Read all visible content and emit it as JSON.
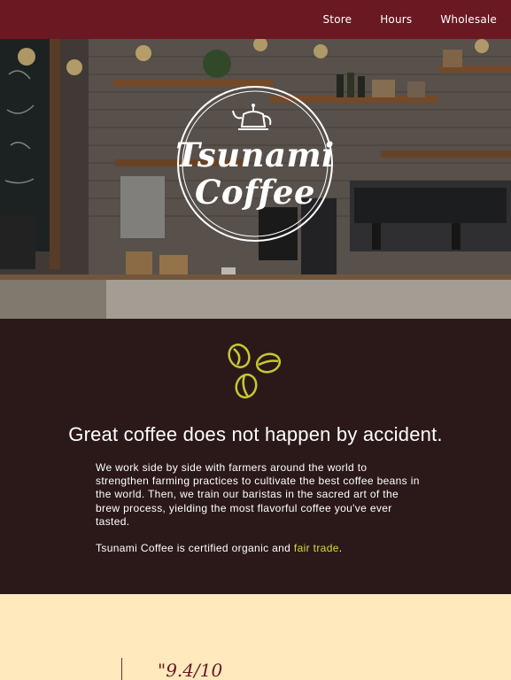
{
  "nav": {
    "links": [
      "Store",
      "Hours",
      "Wholesale"
    ]
  },
  "hero": {
    "logo_line1": "Tsunami",
    "logo_line2": "Coffee",
    "logo_icon": "kettle-icon"
  },
  "intro": {
    "icon": "coffee-beans-icon",
    "headline": "Great coffee does not happen by accident.",
    "paragraph": "We work side by side with farmers around the world to strengthen farming practices to cultivate the best coffee beans in the world. Then, we train our baristas in the sacred art of the brew process, yielding the most flavorful coffee you've ever tasted.",
    "cert_prefix": "Tsunami Coffee is certified organic and ",
    "cert_link": "fair trade",
    "cert_suffix": "."
  },
  "review": {
    "score": "\"9.4/10"
  },
  "colors": {
    "nav_bg": "#6a1822",
    "dark_bg": "#2b1919",
    "accent": "#d6d84a",
    "cream": "#ffe9bd"
  }
}
